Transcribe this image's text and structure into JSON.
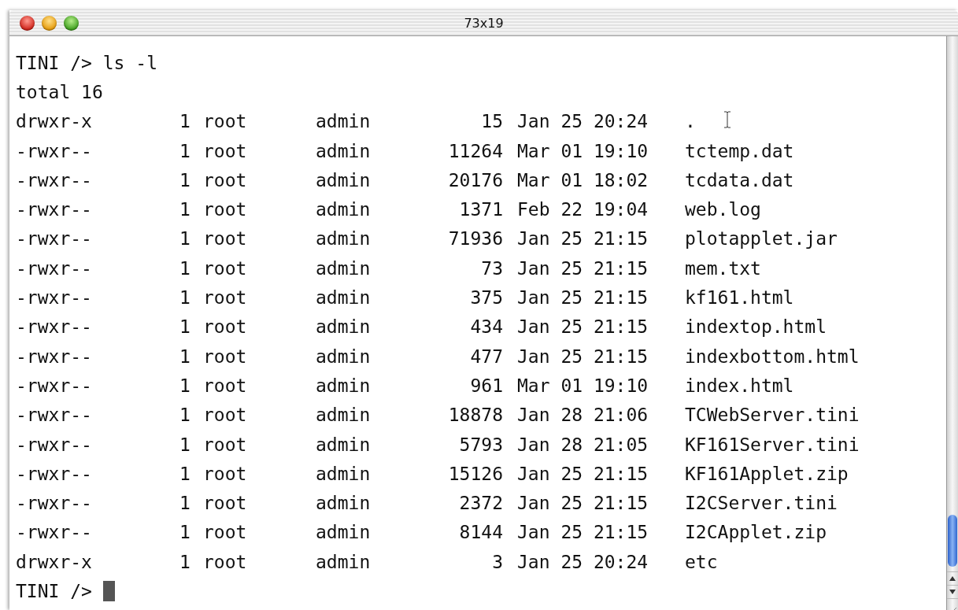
{
  "window": {
    "title": "73x19"
  },
  "terminal": {
    "command_line": "TINI /> ls -l",
    "total_line": "total 16",
    "entries": [
      {
        "permissions": "drwxr-x",
        "links": "1",
        "owner": "root",
        "group": "admin",
        "size": "15",
        "date": "Jan 25 20:24",
        "name": "."
      },
      {
        "permissions": "-rwxr--",
        "links": "1",
        "owner": "root",
        "group": "admin",
        "size": "11264",
        "date": "Mar 01 19:10",
        "name": "tctemp.dat"
      },
      {
        "permissions": "-rwxr--",
        "links": "1",
        "owner": "root",
        "group": "admin",
        "size": "20176",
        "date": "Mar 01 18:02",
        "name": "tcdata.dat"
      },
      {
        "permissions": "-rwxr--",
        "links": "1",
        "owner": "root",
        "group": "admin",
        "size": "1371",
        "date": "Feb 22 19:04",
        "name": "web.log"
      },
      {
        "permissions": "-rwxr--",
        "links": "1",
        "owner": "root",
        "group": "admin",
        "size": "71936",
        "date": "Jan 25 21:15",
        "name": "plotapplet.jar"
      },
      {
        "permissions": "-rwxr--",
        "links": "1",
        "owner": "root",
        "group": "admin",
        "size": "73",
        "date": "Jan 25 21:15",
        "name": "mem.txt"
      },
      {
        "permissions": "-rwxr--",
        "links": "1",
        "owner": "root",
        "group": "admin",
        "size": "375",
        "date": "Jan 25 21:15",
        "name": "kf161.html"
      },
      {
        "permissions": "-rwxr--",
        "links": "1",
        "owner": "root",
        "group": "admin",
        "size": "434",
        "date": "Jan 25 21:15",
        "name": "indextop.html"
      },
      {
        "permissions": "-rwxr--",
        "links": "1",
        "owner": "root",
        "group": "admin",
        "size": "477",
        "date": "Jan 25 21:15",
        "name": "indexbottom.html"
      },
      {
        "permissions": "-rwxr--",
        "links": "1",
        "owner": "root",
        "group": "admin",
        "size": "961",
        "date": "Mar 01 19:10",
        "name": "index.html"
      },
      {
        "permissions": "-rwxr--",
        "links": "1",
        "owner": "root",
        "group": "admin",
        "size": "18878",
        "date": "Jan 28 21:06",
        "name": "TCWebServer.tini"
      },
      {
        "permissions": "-rwxr--",
        "links": "1",
        "owner": "root",
        "group": "admin",
        "size": "5793",
        "date": "Jan 28 21:05",
        "name": "KF161Server.tini"
      },
      {
        "permissions": "-rwxr--",
        "links": "1",
        "owner": "root",
        "group": "admin",
        "size": "15126",
        "date": "Jan 25 21:15",
        "name": "KF161Applet.zip"
      },
      {
        "permissions": "-rwxr--",
        "links": "1",
        "owner": "root",
        "group": "admin",
        "size": "2372",
        "date": "Jan 25 21:15",
        "name": "I2CServer.tini"
      },
      {
        "permissions": "-rwxr--",
        "links": "1",
        "owner": "root",
        "group": "admin",
        "size": "8144",
        "date": "Jan 25 21:15",
        "name": "I2CApplet.zip"
      },
      {
        "permissions": "drwxr-x",
        "links": "1",
        "owner": "root",
        "group": "admin",
        "size": "3",
        "date": "Jan 25 20:24",
        "name": "etc"
      }
    ],
    "prompt": "TINI />"
  }
}
